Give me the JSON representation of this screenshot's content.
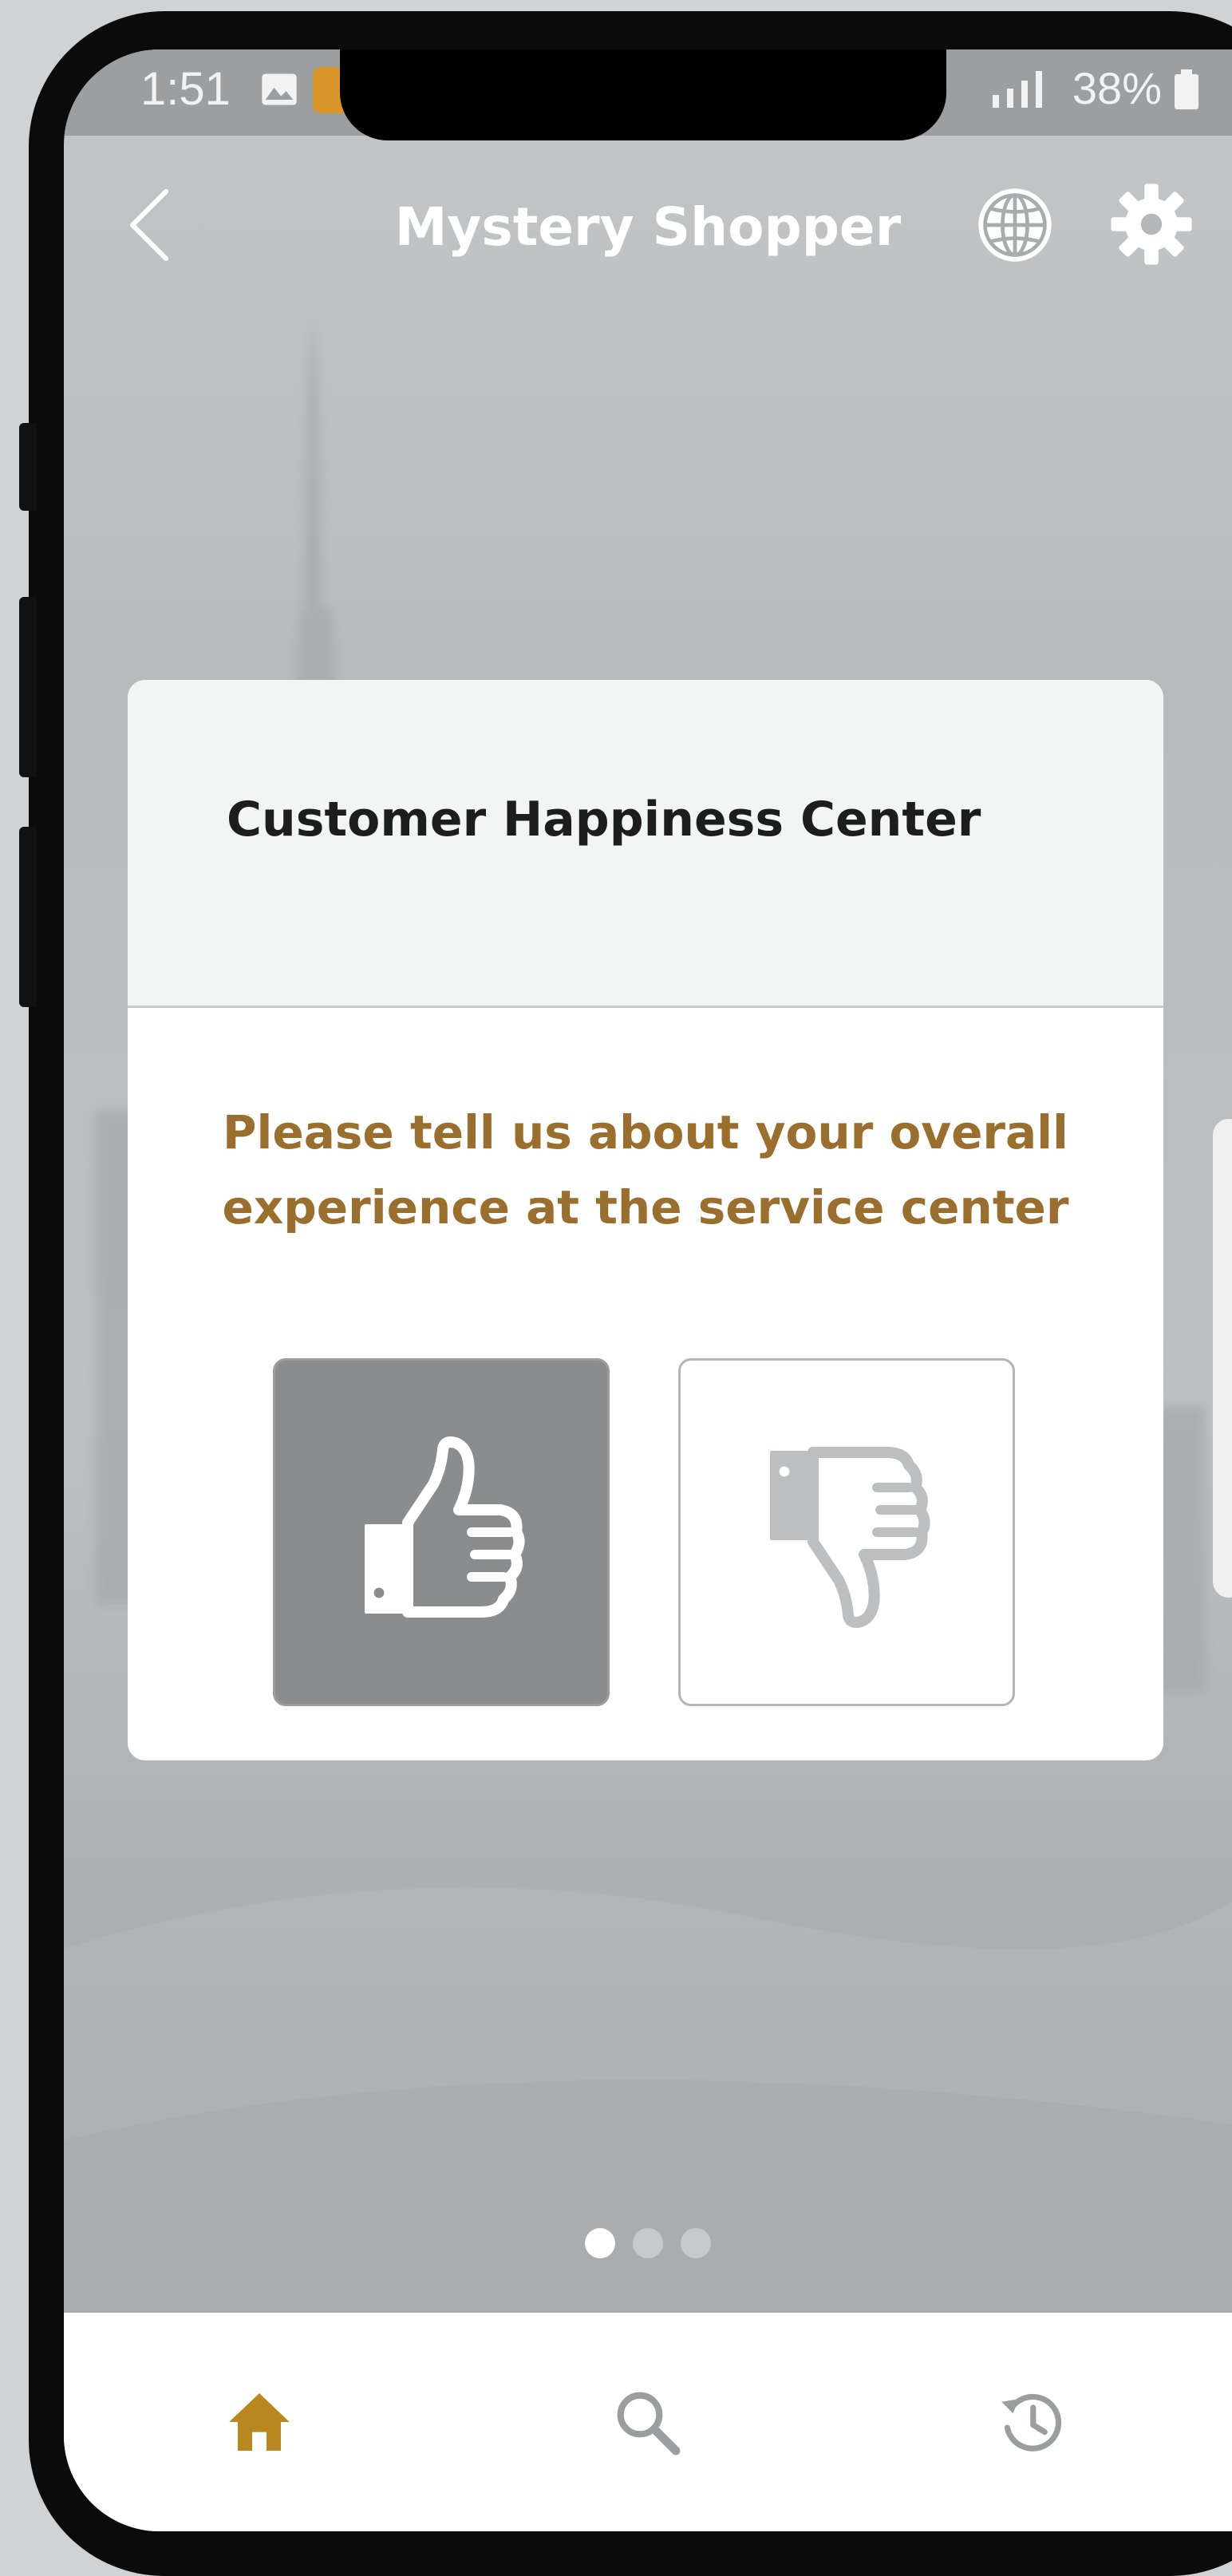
{
  "status_bar": {
    "time": "1:51",
    "battery": "38%"
  },
  "header": {
    "title": "Mystery Shopper",
    "back_icon": "chevron-left-icon",
    "language_icon": "globe-icon",
    "settings_icon": "gear-icon"
  },
  "card": {
    "title": "Customer Happiness Center",
    "question": "Please tell us about your overall experience at the service center",
    "options": [
      {
        "name": "thumbs-up",
        "icon": "thumbs-up-icon",
        "selected": true
      },
      {
        "name": "thumbs-down",
        "icon": "thumbs-down-icon",
        "selected": false
      }
    ]
  },
  "pager": {
    "pages": 3,
    "current": 1
  },
  "bottom_nav": {
    "items": [
      {
        "name": "home",
        "icon": "home-icon",
        "active": true
      },
      {
        "name": "search",
        "icon": "search-icon",
        "active": false
      },
      {
        "name": "history",
        "icon": "history-icon",
        "active": false
      }
    ]
  },
  "colors": {
    "accent": "#B8871F",
    "question_text": "#9A6E2C",
    "selected_option_bg": "#8A8C8E",
    "nav_inactive": "#9B9D9F"
  }
}
